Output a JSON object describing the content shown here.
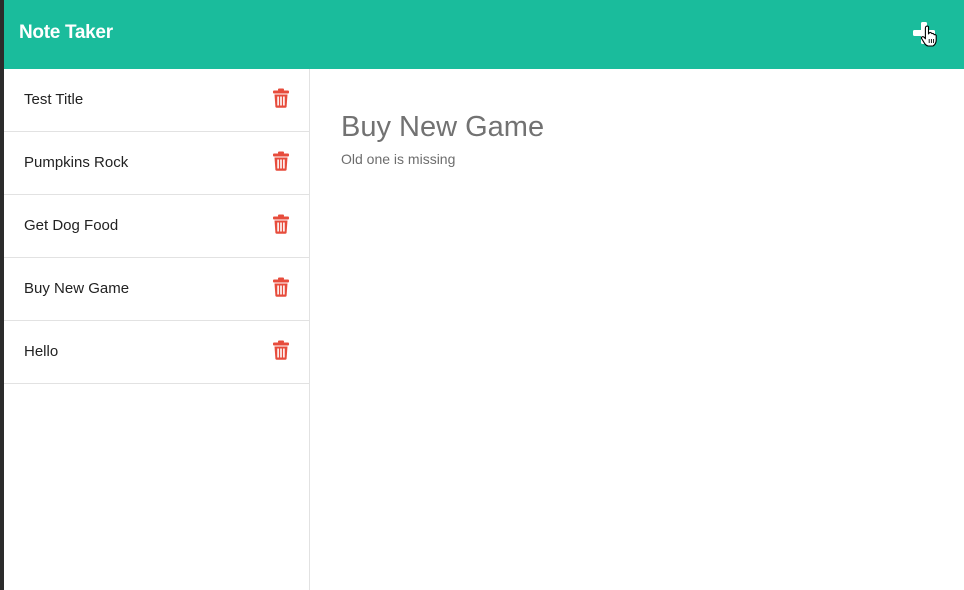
{
  "navbar": {
    "brand": "Note Taker",
    "new_note_icon": "plus-icon",
    "background": "#1abc9c"
  },
  "sidebar": {
    "notes": [
      {
        "title": "Test Title",
        "delete_icon": "trash-icon"
      },
      {
        "title": "Pumpkins Rock",
        "delete_icon": "trash-icon"
      },
      {
        "title": "Get Dog Food",
        "delete_icon": "trash-icon"
      },
      {
        "title": "Buy New Game",
        "delete_icon": "trash-icon"
      },
      {
        "title": "Hello",
        "delete_icon": "trash-icon"
      }
    ]
  },
  "main": {
    "title": "Buy New Game",
    "body": "Old one is missing"
  },
  "colors": {
    "accent": "#1abc9c",
    "delete": "#e74c3c"
  }
}
